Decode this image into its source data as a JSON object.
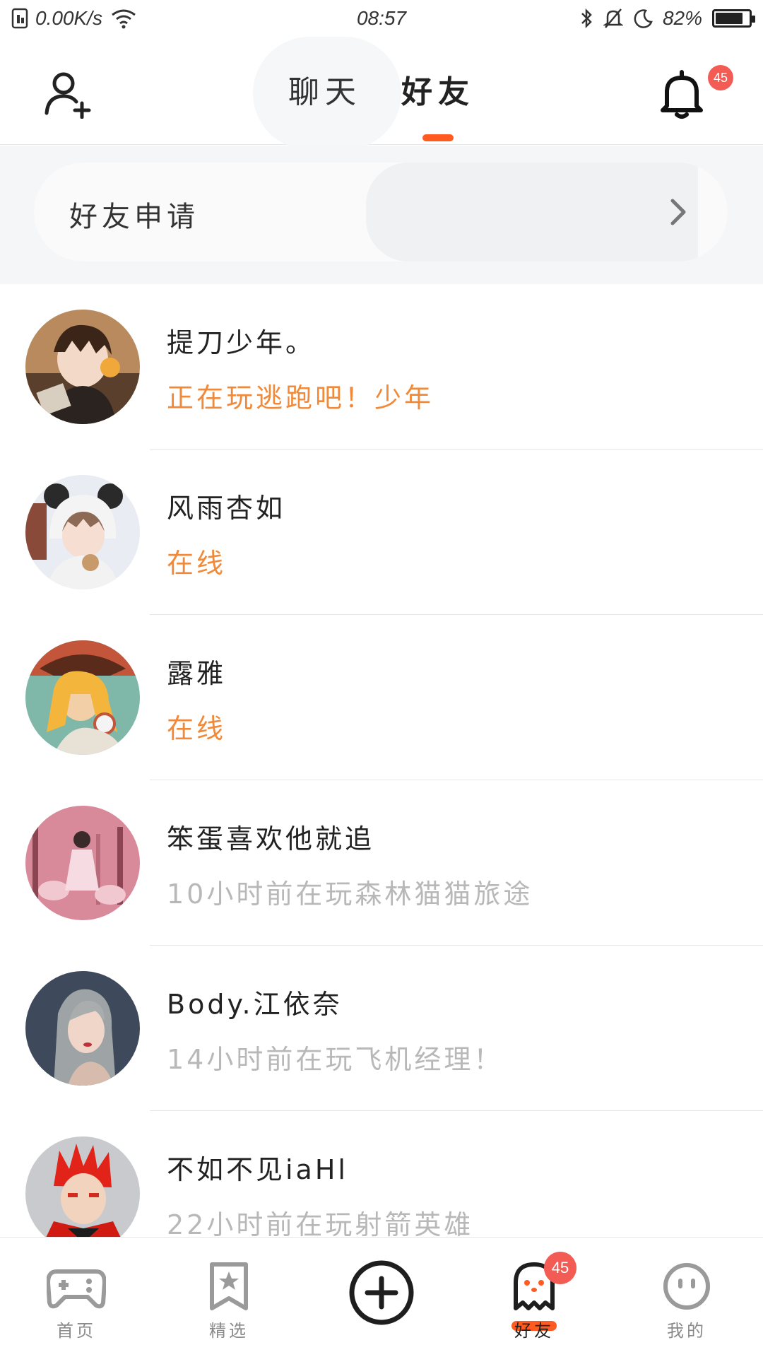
{
  "status_bar": {
    "speed": "0.00K/s",
    "time": "08:57",
    "battery": "82%",
    "battery_level": 0.82
  },
  "header": {
    "tabs": [
      {
        "label": "聊天",
        "active": false
      },
      {
        "label": "好友",
        "active": true
      }
    ],
    "notification_count": "45"
  },
  "friend_request": {
    "label": "好友申请"
  },
  "friends": [
    {
      "name": "提刀少年。",
      "status": "正在玩逃跑吧！少年",
      "status_type": "playing",
      "avatar": "anime-boy-headphones-avatar"
    },
    {
      "name": "风雨杏如",
      "status": "在线",
      "status_type": "online",
      "avatar": "anime-girl-panda-hood-avatar"
    },
    {
      "name": "露雅",
      "status": "在线",
      "status_type": "online",
      "avatar": "anime-girl-blonde-hat-avatar"
    },
    {
      "name": "笨蛋喜欢他就追",
      "status": "10小时前在玩森林猫猫旅途",
      "status_type": "offline",
      "avatar": "pink-carousel-girl-avatar"
    },
    {
      "name": "Body.江依奈",
      "status": "14小时前在玩飞机经理！",
      "status_type": "offline",
      "avatar": "grey-hair-girl-avatar"
    },
    {
      "name": "不如不见iaHl",
      "status": "22小时前在玩射箭英雄",
      "status_type": "offline",
      "avatar": "red-hair-boy-avatar"
    }
  ],
  "bottom_nav": {
    "items": [
      {
        "label": "首页",
        "icon": "gamepad-icon"
      },
      {
        "label": "精选",
        "icon": "star-bookmark-icon"
      },
      {
        "label": "",
        "icon": "plus-circle-icon"
      },
      {
        "label": "好友",
        "icon": "ghost-icon",
        "badge": "45",
        "active": true
      },
      {
        "label": "我的",
        "icon": "smiley-face-icon"
      }
    ]
  },
  "colors": {
    "accent": "#ff5a1f",
    "status_active": "#f08a3a",
    "status_inactive": "#b8b8b8",
    "badge": "#f25c54"
  }
}
